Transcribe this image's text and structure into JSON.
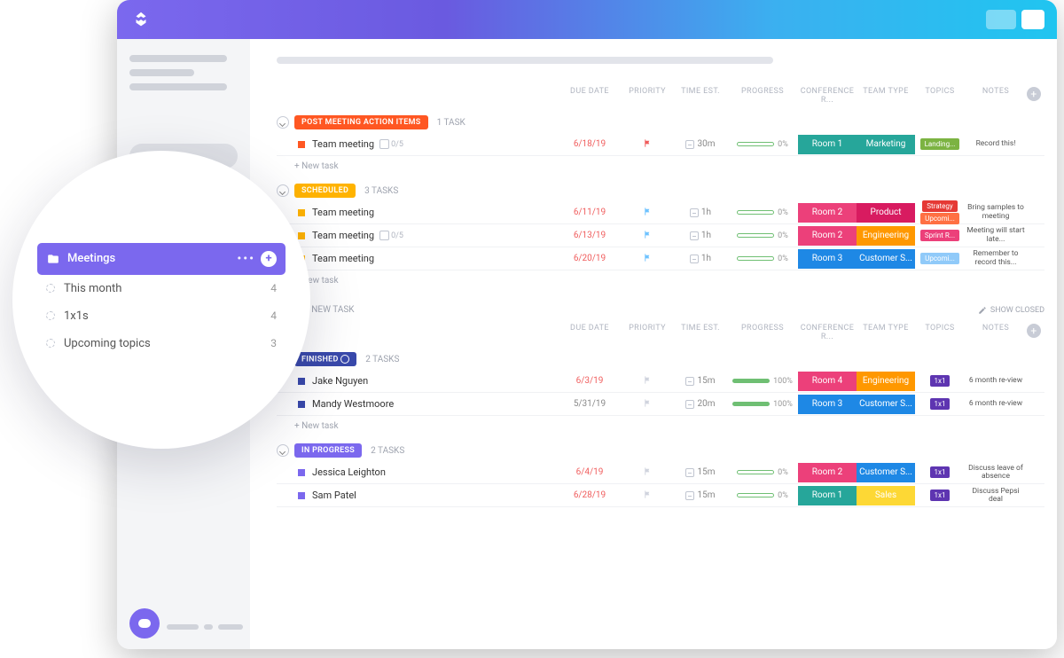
{
  "columns": {
    "due": "DUE DATE",
    "priority": "PRIORITY",
    "time": "TIME EST.",
    "progress": "PROGRESS",
    "room": "CONFERENCE R...",
    "team": "TEAM TYPE",
    "topics": "TOPICS",
    "notes": "NOTES"
  },
  "new_task": "+ New task",
  "toolbar": {
    "new_task_btn": "+ NEW TASK",
    "show_closed": "SHOW CLOSED"
  },
  "popover": {
    "folder": "Meetings",
    "lists": [
      {
        "name": "This month",
        "count": "4"
      },
      {
        "name": "1x1s",
        "count": "4"
      },
      {
        "name": "Upcoming topics",
        "count": "3"
      }
    ]
  },
  "group1": {
    "status": "POST MEETING ACTION ITEMS",
    "color": "#ff5722",
    "count": "1 TASK",
    "rows": [
      {
        "sq": "#ff5722",
        "name": "Team meeting",
        "sub": "0/5",
        "date": "6/18/19",
        "date_neutral": false,
        "flag": "#f05c5c",
        "time": "30m",
        "prog": "0%",
        "prog_full": false,
        "room": {
          "t": "Room 1",
          "c": "#26a69a"
        },
        "team": {
          "t": "Marketing",
          "c": "#26a69a"
        },
        "topics": [
          {
            "t": "Landing...",
            "c": "#7cb342"
          }
        ],
        "notes": "Record this!"
      }
    ]
  },
  "group2": {
    "status": "SCHEDULED",
    "color": "#ffb300",
    "count": "3 TASKS",
    "rows": [
      {
        "sq": "#ffb300",
        "name": "Team meeting",
        "sub": "",
        "date": "6/11/19",
        "date_neutral": false,
        "flag": "#6fc3ff",
        "time": "1h",
        "prog": "0%",
        "prog_full": false,
        "room": {
          "t": "Room 2",
          "c": "#ec407a"
        },
        "team": {
          "t": "Product",
          "c": "#d81b60"
        },
        "topics": [
          {
            "t": "Strategy",
            "c": "#e53935"
          },
          {
            "t": "Upcomi...",
            "c": "#ff7043"
          }
        ],
        "notes": "Bring samples to meeting"
      },
      {
        "sq": "#ffb300",
        "name": "Team meeting",
        "sub": "0/5",
        "date": "6/13/19",
        "date_neutral": false,
        "flag": "#6fc3ff",
        "time": "1h",
        "prog": "0%",
        "prog_full": false,
        "room": {
          "t": "Room 2",
          "c": "#ec407a"
        },
        "team": {
          "t": "Engineering",
          "c": "#ff9800"
        },
        "topics": [
          {
            "t": "Sprint R...",
            "c": "#ec407a"
          }
        ],
        "notes": "Meeting will start late..."
      },
      {
        "sq": "#ffb300",
        "name": "Team meeting",
        "sub": "",
        "date": "6/20/19",
        "date_neutral": false,
        "flag": "#6fc3ff",
        "time": "1h",
        "prog": "0%",
        "prog_full": false,
        "room": {
          "t": "Room 3",
          "c": "#1e88e5"
        },
        "team": {
          "t": "Customer S...",
          "c": "#1e88e5"
        },
        "topics": [
          {
            "t": "Upcomi...",
            "c": "#90caf9"
          }
        ],
        "notes": "Remember to record this..."
      }
    ]
  },
  "group3": {
    "status": "FINISHED",
    "color": "#3949ab",
    "count": "2 TASKS",
    "check": true,
    "rows": [
      {
        "sq": "#3949ab",
        "name": "Jake Nguyen",
        "sub": "",
        "date": "6/3/19",
        "date_neutral": false,
        "flag": "#d0d4de",
        "time": "15m",
        "prog": "100%",
        "prog_full": true,
        "room": {
          "t": "Room 4",
          "c": "#ec407a"
        },
        "team": {
          "t": "Engineering",
          "c": "#ff9800"
        },
        "topics": [
          {
            "t": "1x1",
            "c": "#5e35b1"
          }
        ],
        "notes": "6 month re-view"
      },
      {
        "sq": "#3949ab",
        "name": "Mandy Westmoore",
        "sub": "",
        "date": "5/31/19",
        "date_neutral": true,
        "flag": "#d0d4de",
        "time": "20m",
        "prog": "100%",
        "prog_full": true,
        "room": {
          "t": "Room 3",
          "c": "#1e88e5"
        },
        "team": {
          "t": "Customer S...",
          "c": "#1e88e5"
        },
        "topics": [
          {
            "t": "1x1",
            "c": "#5e35b1"
          }
        ],
        "notes": "6 month re-view"
      }
    ]
  },
  "group4": {
    "status": "IN PROGRESS",
    "color": "#7b68ee",
    "count": "2 TASKS",
    "rows": [
      {
        "sq": "#7b68ee",
        "name": "Jessica Leighton",
        "sub": "",
        "date": "6/4/19",
        "date_neutral": false,
        "flag": "#d0d4de",
        "time": "15m",
        "prog": "0%",
        "prog_full": false,
        "room": {
          "t": "Room 2",
          "c": "#ec407a"
        },
        "team": {
          "t": "Customer S...",
          "c": "#1e88e5"
        },
        "topics": [
          {
            "t": "1x1",
            "c": "#5e35b1"
          }
        ],
        "notes": "Discuss leave of absence"
      },
      {
        "sq": "#7b68ee",
        "name": "Sam Patel",
        "sub": "",
        "date": "6/28/19",
        "date_neutral": false,
        "flag": "#d0d4de",
        "time": "15m",
        "prog": "0%",
        "prog_full": false,
        "room": {
          "t": "Room 1",
          "c": "#26a69a"
        },
        "team": {
          "t": "Sales",
          "c": "#fdd835"
        },
        "topics": [
          {
            "t": "1x1",
            "c": "#5e35b1"
          }
        ],
        "notes": "Discuss Pepsi deal"
      }
    ]
  }
}
